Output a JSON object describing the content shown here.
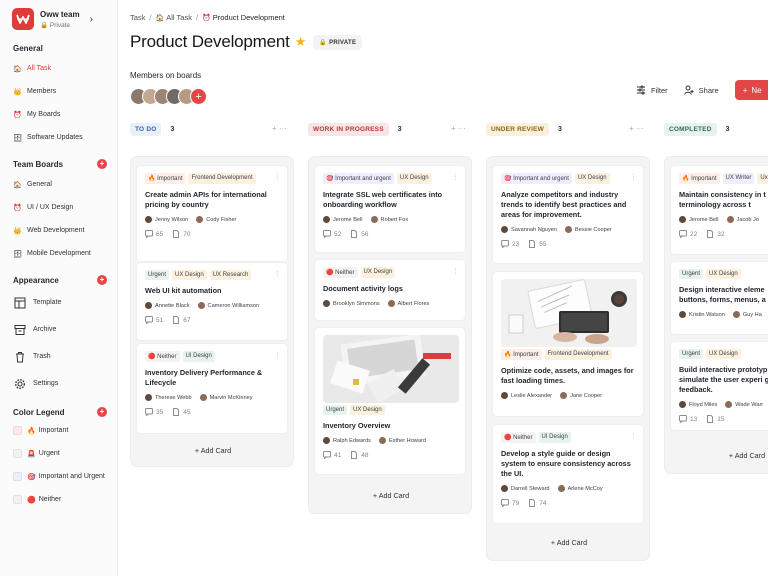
{
  "team": {
    "name": "Oww team",
    "visibility": "Private"
  },
  "sidebar": {
    "general_title": "General",
    "general": [
      {
        "label": "All Task",
        "icon": "house-icon",
        "active": true
      },
      {
        "label": "Members",
        "icon": "members-icon"
      },
      {
        "label": "My Boards",
        "icon": "clock-icon"
      },
      {
        "label": "Software Updates",
        "icon": "tray-icon"
      }
    ],
    "team_boards_title": "Team Boards",
    "team_boards": [
      {
        "label": "General",
        "icon": "house-icon"
      },
      {
        "label": "UI / UX Design",
        "icon": "clock-icon"
      },
      {
        "label": "Web Development",
        "icon": "members-icon"
      },
      {
        "label": "Mobile Development",
        "icon": "tray-icon"
      }
    ],
    "appearance_title": "Appearance",
    "appearance": [
      {
        "label": "Template",
        "icon": "template-icon"
      },
      {
        "label": "Archive",
        "icon": "archive-icon"
      },
      {
        "label": "Trash",
        "icon": "trash-icon"
      },
      {
        "label": "Settings",
        "icon": "gear-icon"
      }
    ],
    "legend_title": "Color Legend",
    "legend": [
      {
        "label": "Important",
        "emoji": "🔥"
      },
      {
        "label": "Urgent",
        "emoji": "🚨"
      },
      {
        "label": "Important and Urgent",
        "emoji": "🎯"
      },
      {
        "label": "Neither",
        "emoji": "🔴"
      }
    ]
  },
  "breadcrumb": [
    "Task",
    "All Task",
    "Product Development"
  ],
  "page": {
    "title": "Product Development",
    "badge": "PRIVATE",
    "members_label": "Members on boards"
  },
  "toolbar": {
    "filter": "Filter",
    "share": "Share",
    "new": "Ne"
  },
  "add_card_label": "+ Add Card",
  "columns": [
    {
      "name": "TO DO",
      "count": "3"
    },
    {
      "name": "WORK IN PROGRESS",
      "count": "3"
    },
    {
      "name": "UNDER REVIEW",
      "count": "3"
    },
    {
      "name": "COMPLETED",
      "count": "3"
    }
  ],
  "cards": {
    "todo": [
      {
        "tags": [
          "🔥 Important",
          "Frontend Development"
        ],
        "title": "Create admin APIs for international pricing by country",
        "people": [
          "Jenny Wilson",
          "Cody Fisher"
        ],
        "comments": "65",
        "files": "70"
      },
      {
        "tags": [
          "Urgent",
          "UX Design",
          "UX Research"
        ],
        "title": "Web UI kit automation",
        "people": [
          "Annette Black",
          "Cameron Williamson"
        ],
        "comments": "51",
        "files": "67"
      },
      {
        "tags": [
          "Neither",
          "UI Design"
        ],
        "title": "Inventory Delivery Performance & Lifecycle",
        "people": [
          "Therese Webb",
          "Marvin McKinney"
        ],
        "comments": "35",
        "files": "45"
      }
    ],
    "wip": [
      {
        "tags": [
          "Important and urgent",
          "UX Design"
        ],
        "title": "Integrate SSL web certificates into onboarding workflow",
        "people": [
          "Jerome Bell",
          "Robert Fox"
        ],
        "comments": "52",
        "files": "56"
      },
      {
        "tags": [
          "Neither",
          "UX Design"
        ],
        "title": "Document activity logs",
        "people": [
          "Brooklyn Simmons",
          "Albert Flores"
        ]
      },
      {
        "tags": [
          "Urgent",
          "UX Design"
        ],
        "title": "Inventory Overview",
        "people": [
          "Ralph Edwards",
          "Esther Howard"
        ],
        "comments": "41",
        "files": "48"
      }
    ],
    "review": [
      {
        "tags": [
          "Important and urgent",
          "UX Design"
        ],
        "title": "Analyze competitors and industry trends to identify best practices and areas for improvement.",
        "people": [
          "Savannah Nguyen",
          "Bessie Cooper"
        ],
        "comments": "23",
        "files": "55"
      },
      {
        "tags": [
          "Important",
          "Frontend Development"
        ],
        "title": "Optimize code, assets, and images for fast loading times.",
        "people": [
          "Leslie Alexander",
          "Jane Cooper"
        ]
      },
      {
        "tags": [
          "Neither",
          "UI Design"
        ],
        "title": "Develop a style guide or design system to ensure consistency across the UI.",
        "people": [
          "Darrell Steward",
          "Arlene McCoy"
        ],
        "comments": "79",
        "files": "74"
      }
    ],
    "completed": [
      {
        "tags": [
          "Important",
          "UX Writer",
          "Ux"
        ],
        "title": "Maintain consistency in t and terminology across t",
        "people": [
          "Jerome Bell",
          "Jacob Jo"
        ],
        "comments": "22",
        "files": "32"
      },
      {
        "tags": [
          "Urgent",
          "UX Design"
        ],
        "title": "Design interactive eleme buttons, forms, menus, a",
        "people": [
          "Kristin Watson",
          "Guy Ha"
        ]
      },
      {
        "tags": [
          "Urgent",
          "UX Design"
        ],
        "title": "Build interactive prototyp simulate the user experi gather feedback.",
        "people": [
          "Floyd Miles",
          "Wade Warr"
        ],
        "comments": "13",
        "files": "15"
      }
    ]
  },
  "colors": {
    "accent": "#e34646",
    "todo": "#e8f0fb",
    "wip": "#fbe4e4",
    "review": "#fbf0dc",
    "completed": "#e6f3ee"
  }
}
